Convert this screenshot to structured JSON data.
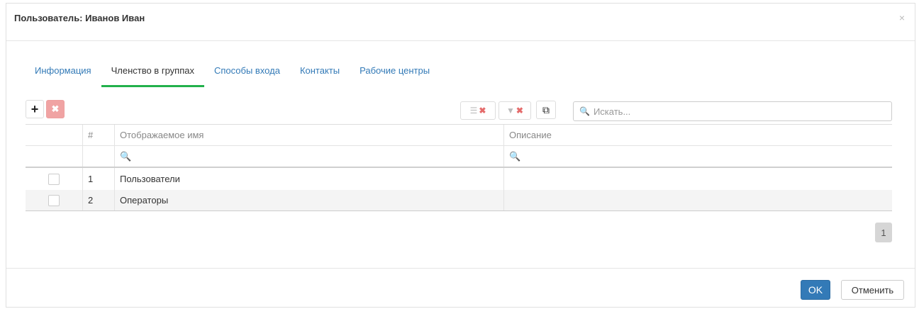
{
  "dialog": {
    "title": "Пользователь: Иванов Иван",
    "close_glyph": "×"
  },
  "tabs": [
    {
      "label": "Информация",
      "active": false
    },
    {
      "label": "Членство в группах",
      "active": true
    },
    {
      "label": "Способы входа",
      "active": false
    },
    {
      "label": "Контакты",
      "active": false
    },
    {
      "label": "Рабочие центры",
      "active": false
    }
  ],
  "toolbar": {
    "add_glyph": "+",
    "delete_glyph": "✖",
    "clear_selection_glyph": "☰",
    "clear_filter_glyph": "▼",
    "x_glyph": "✖",
    "copy_glyph": "⧉",
    "search_glyph": "🔍",
    "search_placeholder": "Искать..."
  },
  "grid": {
    "columns": [
      "",
      "#",
      "Отображаемое имя",
      "Описание"
    ],
    "filter_glyph": "🔍",
    "rows": [
      {
        "num": "1",
        "name": "Пользователи",
        "description": ""
      },
      {
        "num": "2",
        "name": "Операторы",
        "description": ""
      }
    ]
  },
  "pager": {
    "page": "1"
  },
  "footer": {
    "ok_label": "OK",
    "cancel_label": "Отменить"
  },
  "colors": {
    "accent": "#337ab7",
    "tab_underline": "#22b14c",
    "delete_button": "#f0a3a3"
  },
  "icons": [
    "close-icon",
    "plus-icon",
    "delete-icon",
    "clear-selection-icon",
    "clear-filter-icon",
    "copy-icon",
    "search-icon"
  ]
}
